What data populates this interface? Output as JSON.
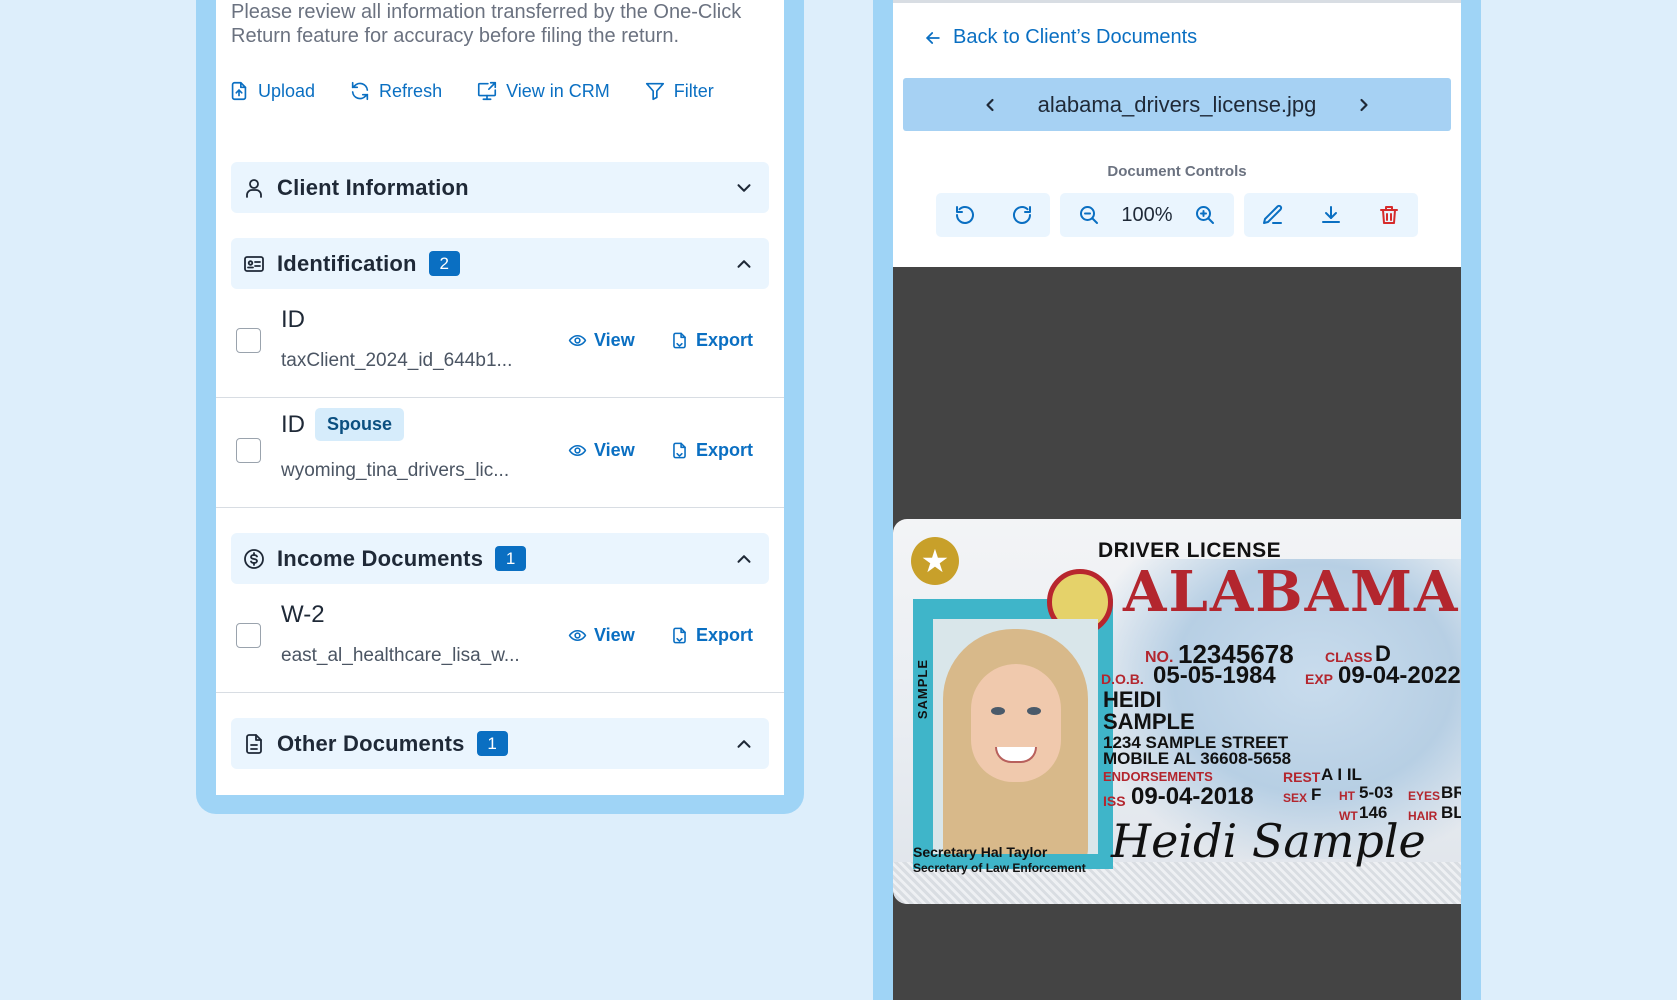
{
  "left_panel": {
    "notice": "Please review all information transferred by the One-Click Return feature for accuracy before filing the return.",
    "toolbar": {
      "upload": "Upload",
      "refresh": "Refresh",
      "view_in_crm": "View in CRM",
      "filter": "Filter"
    },
    "sections": {
      "client_information": {
        "title": "Client Information",
        "expanded": false
      },
      "identification": {
        "title": "Identification",
        "count": "2",
        "expanded": true
      },
      "income_documents": {
        "title": "Income Documents",
        "count": "1",
        "expanded": true
      },
      "other_documents": {
        "title": "Other Documents",
        "count": "1",
        "expanded": true
      }
    },
    "documents": [
      {
        "title": "ID",
        "tag": "",
        "file": "taxClient_2024_id_644b1...",
        "view": "View",
        "export": "Export"
      },
      {
        "title": "ID",
        "tag": "Spouse",
        "file": "wyoming_tina_drivers_lic...",
        "view": "View",
        "export": "Export"
      },
      {
        "title": "W-2",
        "tag": "",
        "file": "east_al_healthcare_lisa_w...",
        "view": "View",
        "export": "Export"
      }
    ]
  },
  "right_panel": {
    "back_link": "Back to Client’s Documents",
    "file_name": "alabama_drivers_license.jpg",
    "controls_label": "Document Controls",
    "zoom": "100%",
    "license": {
      "header": "DRIVER LICENSE",
      "state": "ALABAMA",
      "sample_vertical": "SAMPLE",
      "no_label": "NO.",
      "no_value": "12345678",
      "class_label": "CLASS",
      "class_value": "D",
      "dob_label": "D.O.B.",
      "dob_value": "05-05-1984",
      "exp_label": "EXP",
      "exp_value": "09-04-2022",
      "first_name": "HEIDI",
      "last_name": "SAMPLE",
      "address1": "1234 SAMPLE STREET",
      "address2": "MOBILE AL 36608-5658",
      "endorsements_label": "ENDORSEMENTS",
      "rest_label": "REST",
      "rest_value": "A I IL",
      "iss_label": "ISS",
      "iss_value": "09-04-2018",
      "sex_label": "SEX",
      "sex_value": "F",
      "ht_label": "HT",
      "ht_value": "5-03",
      "wt_label": "WT",
      "wt_value": "146",
      "eyes_label": "EYES",
      "eyes_value": "BR",
      "hair_label": "HAIR",
      "hair_value": "BL",
      "secretary_name": "Secretary Hal Taylor",
      "secretary_title": "Secretary of Law Enforcement",
      "signature": "Heidi Sample"
    }
  },
  "colors": {
    "accent": "#0a6fc2",
    "frame": "#9fd4f6",
    "background": "#ddeefb",
    "section_bg": "#eaf5fe",
    "danger": "#d62b2b",
    "viewer_bg": "#444444"
  }
}
